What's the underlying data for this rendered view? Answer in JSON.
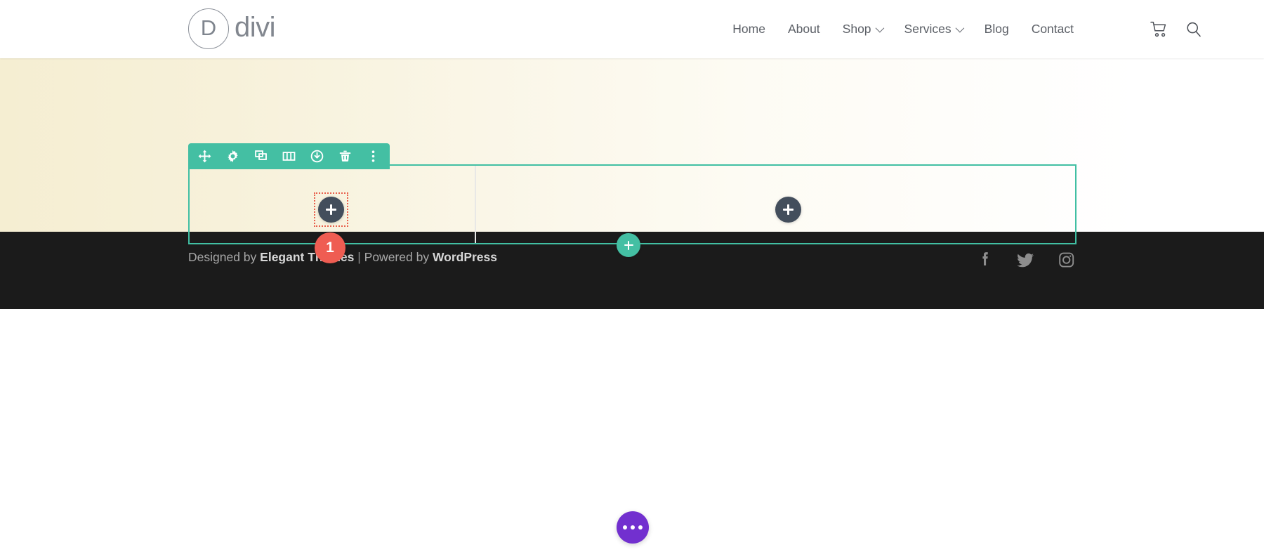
{
  "header": {
    "logo": {
      "mark_letter": "D",
      "text": "divi",
      "name": "divi-logo"
    },
    "nav": [
      {
        "label": "Home",
        "has_dropdown": false
      },
      {
        "label": "About",
        "has_dropdown": false
      },
      {
        "label": "Shop",
        "has_dropdown": true
      },
      {
        "label": "Services",
        "has_dropdown": true
      },
      {
        "label": "Blog",
        "has_dropdown": false
      },
      {
        "label": "Contact",
        "has_dropdown": false
      }
    ],
    "icons": [
      {
        "name": "cart-icon"
      },
      {
        "name": "search-icon"
      }
    ]
  },
  "builder": {
    "accent_color": "#44bfa3",
    "badge_color": "#ef5d52",
    "placeholder_border_color": "#e8604c",
    "add_button_color": "#434e5c",
    "row_badge": "1",
    "toolbar": [
      {
        "name": "move-row-icon",
        "title": "Move Row"
      },
      {
        "name": "gear-icon",
        "title": "Row Settings"
      },
      {
        "name": "duplicate-icon",
        "title": "Duplicate Row"
      },
      {
        "name": "column-structure-icon",
        "title": "Change Column Structure"
      },
      {
        "name": "save-to-library-icon",
        "title": "Save to Library"
      },
      {
        "name": "trash-icon",
        "title": "Delete Row"
      },
      {
        "name": "more-options-icon",
        "title": "More Options"
      }
    ],
    "add_module_left": {
      "name": "add-module-button",
      "label": "+"
    },
    "add_module_right": {
      "name": "add-module-button",
      "label": "+"
    },
    "add_row": {
      "name": "add-row-button",
      "label": "+"
    }
  },
  "footer": {
    "credit_prefix": "Designed by ",
    "credit_brand": "Elegant Themes",
    "credit_separator": " | ",
    "credit_middle": "Powered by ",
    "credit_platform": "WordPress",
    "social": [
      {
        "name": "facebook-icon"
      },
      {
        "name": "twitter-icon"
      },
      {
        "name": "instagram-icon"
      }
    ]
  },
  "fab": {
    "name": "divi-builder-fab",
    "color": "#7230cf"
  }
}
